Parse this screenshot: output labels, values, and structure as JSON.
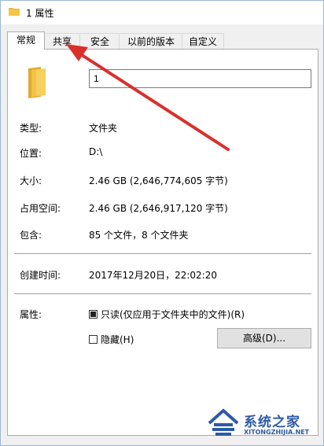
{
  "window": {
    "title": "1 属性",
    "tabs": [
      {
        "label": "常规",
        "active": true
      },
      {
        "label": "共享",
        "active": false
      },
      {
        "label": "安全",
        "active": false
      },
      {
        "label": "以前的版本",
        "active": false
      },
      {
        "label": "自定义",
        "active": false
      }
    ]
  },
  "general": {
    "name_value": "1",
    "rows": [
      {
        "label": "类型:",
        "value": "文件夹"
      },
      {
        "label": "位置:",
        "value": "D:\\"
      },
      {
        "label": "大小:",
        "value": "2.46 GB (2,646,774,605 字节)"
      },
      {
        "label": "占用空间:",
        "value": "2.46 GB (2,646,917,120 字节)"
      },
      {
        "label": "包含:",
        "value": "85 个文件，8 个文件夹"
      }
    ],
    "created": {
      "label": "创建时间:",
      "value": "2017年12月20日，22:02:20"
    },
    "attributes": {
      "label": "属性:",
      "readonly_label": "只读(仅应用于文件夹中的文件)(R)",
      "readonly_state": "indeterminate",
      "hidden_label": "隐藏(H)",
      "hidden_checked": false,
      "advanced_button": "高级(D)..."
    }
  },
  "watermark": {
    "title": "系统之家",
    "subtitle": "XITONGZHIJIA.NET"
  },
  "colors": {
    "arrow": "#d9302c",
    "folder": "#f5c542",
    "watermark": "#2d5aa5"
  }
}
